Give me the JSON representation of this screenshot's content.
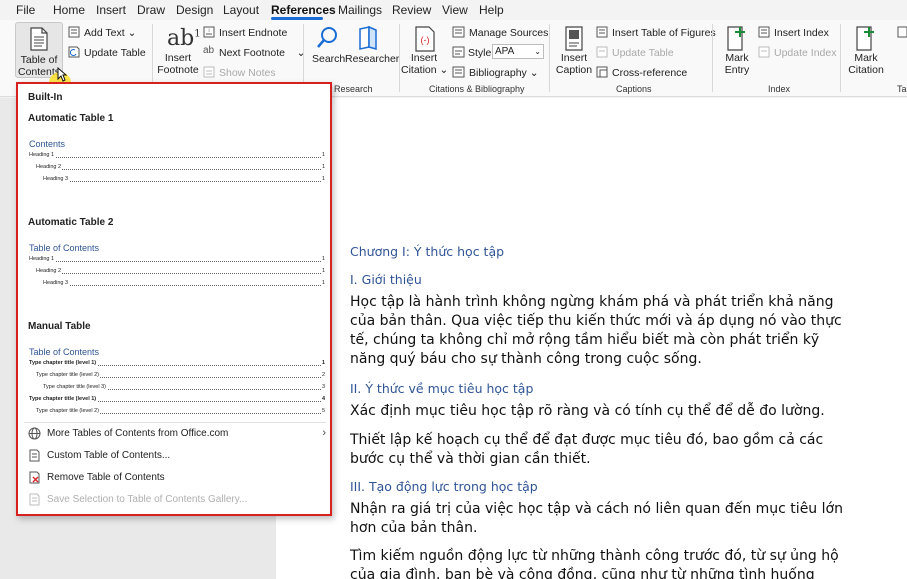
{
  "menu": {
    "items": [
      "File",
      "Home",
      "Insert",
      "Draw",
      "Design",
      "Layout",
      "References",
      "Mailings",
      "Review",
      "View",
      "Help"
    ],
    "active": "References"
  },
  "ribbon": {
    "toc": {
      "line1": "Table of",
      "line2": "Contents"
    },
    "add_text": "Add Text",
    "update_table": "Update Table",
    "insert_footnote": {
      "line1": "Insert",
      "line2": "Footnote"
    },
    "insert_endnote": "Insert Endnote",
    "next_footnote": "Next Footnote",
    "show_notes": "Show Notes",
    "search": "Search",
    "researcher": "Researcher",
    "research_group": "Research",
    "insert_citation": {
      "line1": "Insert",
      "line2": "Citation"
    },
    "manage_sources": "Manage Sources",
    "style_label": "Style:",
    "style_value": "APA",
    "bibliography": "Bibliography",
    "citations_group": "Citations & Bibliography",
    "insert_caption": {
      "line1": "Insert",
      "line2": "Caption"
    },
    "insert_table_of_figures": "Insert Table of Figures",
    "update_table_captions": "Update Table",
    "cross_reference": "Cross-reference",
    "captions_group": "Captions",
    "mark_entry": {
      "line1": "Mark",
      "line2": "Entry"
    },
    "insert_index": "Insert Index",
    "update_index": "Update Index",
    "index_group": "Index",
    "mark_citation": {
      "line1": "Mark",
      "line2": "Citation"
    },
    "table_group_partial": "Ta"
  },
  "dropdown": {
    "builtin": "Built-In",
    "auto1": {
      "name": "Automatic Table 1",
      "preview_title": "Contents",
      "entries": [
        {
          "text": "Heading 1",
          "page": "1"
        },
        {
          "text": "Heading 2",
          "page": "1"
        },
        {
          "text": "Heading 3",
          "page": "1"
        }
      ]
    },
    "auto2": {
      "name": "Automatic Table 2",
      "preview_title": "Table of Contents",
      "entries": [
        {
          "text": "Heading 1",
          "page": "1"
        },
        {
          "text": "Heading 2",
          "page": "1"
        },
        {
          "text": "Heading 3",
          "page": "1"
        }
      ]
    },
    "manual": {
      "name": "Manual Table",
      "preview_title": "Table of Contents",
      "entries": [
        {
          "text": "Type chapter title (level 1)",
          "page": "1"
        },
        {
          "text": "Type chapter title (level 2)",
          "page": "2"
        },
        {
          "text": "Type chapter title (level 3)",
          "page": "3"
        },
        {
          "text": "Type chapter title (level 1)",
          "page": "4"
        },
        {
          "text": "Type chapter title (level 2)",
          "page": "5"
        }
      ]
    },
    "more": "More Tables of Contents from Office.com",
    "custom": "Custom Table of Contents...",
    "remove": "Remove Table of Contents",
    "save": "Save Selection to Table of Contents Gallery..."
  },
  "document": {
    "chapter": "Chương I: Ý thức học tập",
    "h1": "I. Giới thiệu",
    "p1": "Học tập là hành trình không ngừng khám phá và phát triển khả năng của bản thân. Qua việc tiếp thu kiến thức mới và áp dụng nó vào thực tế, chúng ta không chỉ mở rộng tầm hiểu biết mà còn phát triển kỹ năng quý báu cho sự thành công trong cuộc sống.",
    "h2": "II. Ý thức về mục tiêu học tập",
    "p2": "Xác định mục tiêu học tập rõ ràng và có tính cụ thể để dễ đo lường.",
    "p3": "Thiết lập kế hoạch cụ thể để đạt được mục tiêu đó, bao gồm cả các bước cụ thể và thời gian cần thiết.",
    "h3": "III. Tạo động lực trong học tập",
    "p4": "Nhận ra giá trị của việc học tập và cách nó liên quan đến mục tiêu lớn hơn của bản thân.",
    "p5": "Tìm kiếm nguồn động lực từ những thành công trước đó, từ sự ủng hộ của gia đình, bạn bè và cộng đồng, cũng như từ những tình huống thách thức."
  },
  "colors": {
    "accent": "#1a6dd4",
    "highlight_border": "#d6211f",
    "heading_blue": "#2f5496"
  }
}
